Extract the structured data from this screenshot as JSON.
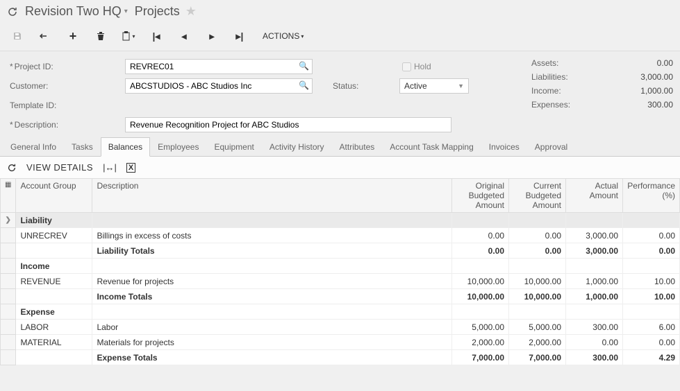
{
  "breadcrumb": {
    "org": "Revision Two HQ",
    "page": "Projects"
  },
  "toolbar": {
    "actions_label": "ACTIONS"
  },
  "form": {
    "project_id_label": "Project ID:",
    "project_id": "REVREC01",
    "customer_label": "Customer:",
    "customer": "ABCSTUDIOS - ABC Studios Inc",
    "template_label": "Template ID:",
    "template": "",
    "description_label": "Description:",
    "description": "Revenue Recognition Project for ABC Studios",
    "hold_label": "Hold",
    "status_label": "Status:",
    "status_value": "Active"
  },
  "summary": {
    "assets_label": "Assets:",
    "assets": "0.00",
    "liabilities_label": "Liabilities:",
    "liabilities": "3,000.00",
    "income_label": "Income:",
    "income": "1,000.00",
    "expenses_label": "Expenses:",
    "expenses": "300.00"
  },
  "tabs": [
    "General Info",
    "Tasks",
    "Balances",
    "Employees",
    "Equipment",
    "Activity History",
    "Attributes",
    "Account Task Mapping",
    "Invoices",
    "Approval"
  ],
  "active_tab": "Balances",
  "grid_toolbar": {
    "view_details": "VIEW DETAILS"
  },
  "grid": {
    "headers": {
      "account_group": "Account Group",
      "description": "Description",
      "original": "Original Budgeted Amount",
      "current": "Current Budgeted Amount",
      "actual": "Actual Amount",
      "performance": "Performance (%)"
    },
    "rows": [
      {
        "type": "group",
        "selected": true,
        "acct": "Liability"
      },
      {
        "type": "data",
        "acct": "UNRECREV",
        "desc": "Billings in excess of costs",
        "orig": "0.00",
        "curr": "0.00",
        "actual": "3,000.00",
        "perf": "0.00"
      },
      {
        "type": "total",
        "desc": "Liability Totals",
        "orig": "0.00",
        "curr": "0.00",
        "actual": "3,000.00",
        "perf": "0.00"
      },
      {
        "type": "group",
        "acct": "Income"
      },
      {
        "type": "data",
        "acct": "REVENUE",
        "desc": "Revenue for projects",
        "orig": "10,000.00",
        "curr": "10,000.00",
        "actual": "1,000.00",
        "perf": "10.00"
      },
      {
        "type": "total",
        "desc": "Income Totals",
        "orig": "10,000.00",
        "curr": "10,000.00",
        "actual": "1,000.00",
        "perf": "10.00"
      },
      {
        "type": "group",
        "acct": "Expense"
      },
      {
        "type": "data",
        "acct": "LABOR",
        "desc": "Labor",
        "orig": "5,000.00",
        "curr": "5,000.00",
        "actual": "300.00",
        "perf": "6.00"
      },
      {
        "type": "data",
        "acct": "MATERIAL",
        "desc": "Materials for projects",
        "orig": "2,000.00",
        "curr": "2,000.00",
        "actual": "0.00",
        "perf": "0.00"
      },
      {
        "type": "total",
        "desc": "Expense Totals",
        "orig": "7,000.00",
        "curr": "7,000.00",
        "actual": "300.00",
        "perf": "4.29"
      }
    ]
  }
}
